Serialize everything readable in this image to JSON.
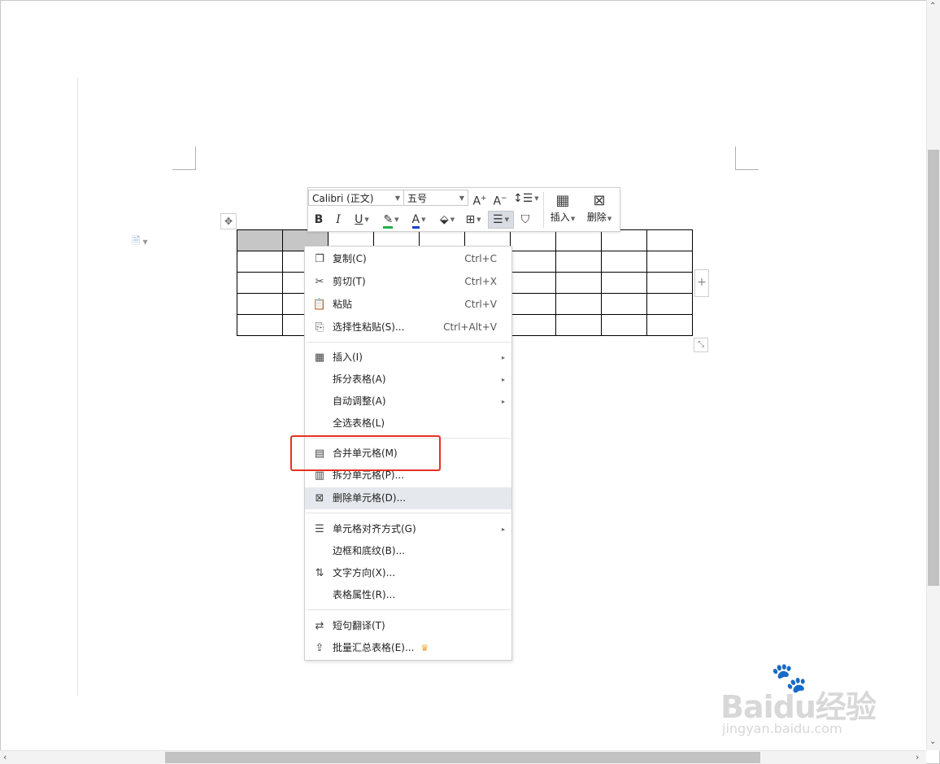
{
  "toolbar": {
    "font_name": "Calibri (正文)",
    "font_size": "五号",
    "bold": "B",
    "italic": "I",
    "underline": "U",
    "font_color": "A",
    "insert_label": "插入",
    "delete_label": "删除"
  },
  "context_menu": {
    "items": [
      {
        "label": "复制(C)",
        "shortcut": "Ctrl+C",
        "icon": "copy-icon"
      },
      {
        "label": "剪切(T)",
        "shortcut": "Ctrl+X",
        "icon": "scissors-icon"
      },
      {
        "label": "粘贴",
        "shortcut": "Ctrl+V",
        "icon": "paste-icon"
      },
      {
        "label": "选择性粘贴(S)...",
        "shortcut": "Ctrl+Alt+V",
        "icon": "paste-special-icon"
      },
      {
        "label": "插入(I)",
        "icon": "table-insert-icon",
        "submenu": true
      },
      {
        "label": "拆分表格(A)",
        "submenu": true
      },
      {
        "label": "自动调整(A)",
        "submenu": true
      },
      {
        "label": "全选表格(L)"
      },
      {
        "label": "合并单元格(M)",
        "icon": "merge-cells-icon"
      },
      {
        "label": "拆分单元格(P)...",
        "icon": "split-cells-icon"
      },
      {
        "label": "删除单元格(D)...",
        "icon": "delete-cells-icon",
        "hovered": true
      },
      {
        "label": "单元格对齐方式(G)",
        "icon": "cell-align-icon",
        "submenu": true
      },
      {
        "label": "边框和底纹(B)..."
      },
      {
        "label": "文字方向(X)...",
        "icon": "text-direction-icon"
      },
      {
        "label": "表格属性(R)..."
      },
      {
        "label": "短句翻译(T)",
        "icon": "translate-icon"
      },
      {
        "label": "批量汇总表格(E)...",
        "icon": "batch-summary-icon",
        "premium": true
      }
    ]
  },
  "watermark": {
    "brand": "Bai",
    "brand_suffix": "du",
    "brand_cn": "经验",
    "url": "jingyan.baidu.com"
  },
  "colors": {
    "highlight_box": "#e63222",
    "highlight_green": "#22b14c",
    "font_color_blue": "#1a3fd0",
    "selected_cell": "#c6c6c6",
    "menu_hover": "#e5e8ec"
  }
}
